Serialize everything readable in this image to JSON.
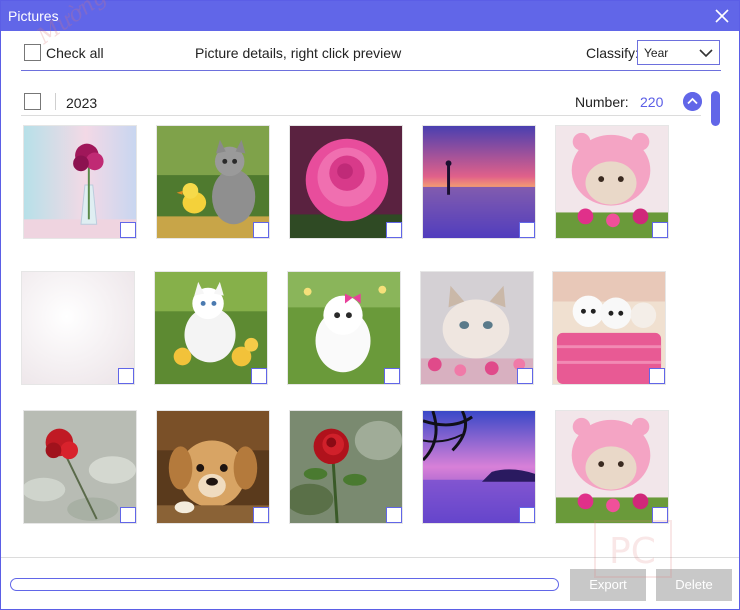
{
  "window": {
    "title": "Pictures"
  },
  "toolbar": {
    "check_all_label": "Check all",
    "details_text": "Picture details, right click preview",
    "classify_label": "Classify:",
    "classify_value": "Year"
  },
  "group": {
    "year": "2023",
    "number_label": "Number:",
    "number_value": "220"
  },
  "thumbnails": [
    {
      "subject": "pink flowers in vase"
    },
    {
      "subject": "kitten and chick"
    },
    {
      "subject": "pink rose"
    },
    {
      "subject": "sunset over water"
    },
    {
      "subject": "cat in pink hood"
    },
    {
      "subject": "white faded image"
    },
    {
      "subject": "white kitten with chicks"
    },
    {
      "subject": "white kitten with pink bow"
    },
    {
      "subject": "kitten in flowers"
    },
    {
      "subject": "kittens in pink basket"
    },
    {
      "subject": "red rose"
    },
    {
      "subject": "puppy"
    },
    {
      "subject": "red rose in garden"
    },
    {
      "subject": "purple lake with tree"
    },
    {
      "subject": "cat in pink hood"
    }
  ],
  "footer": {
    "export_label": "Export",
    "delete_label": "Delete",
    "progress_fraction": 0.0
  },
  "watermark": {
    "text": "Mường PC",
    "logo_text": "PC"
  },
  "colors": {
    "accent": "#6166e8",
    "disabled_button": "#c8c8c8"
  },
  "icons": [
    "close-icon",
    "chevron-down-icon",
    "chevron-up-icon"
  ]
}
